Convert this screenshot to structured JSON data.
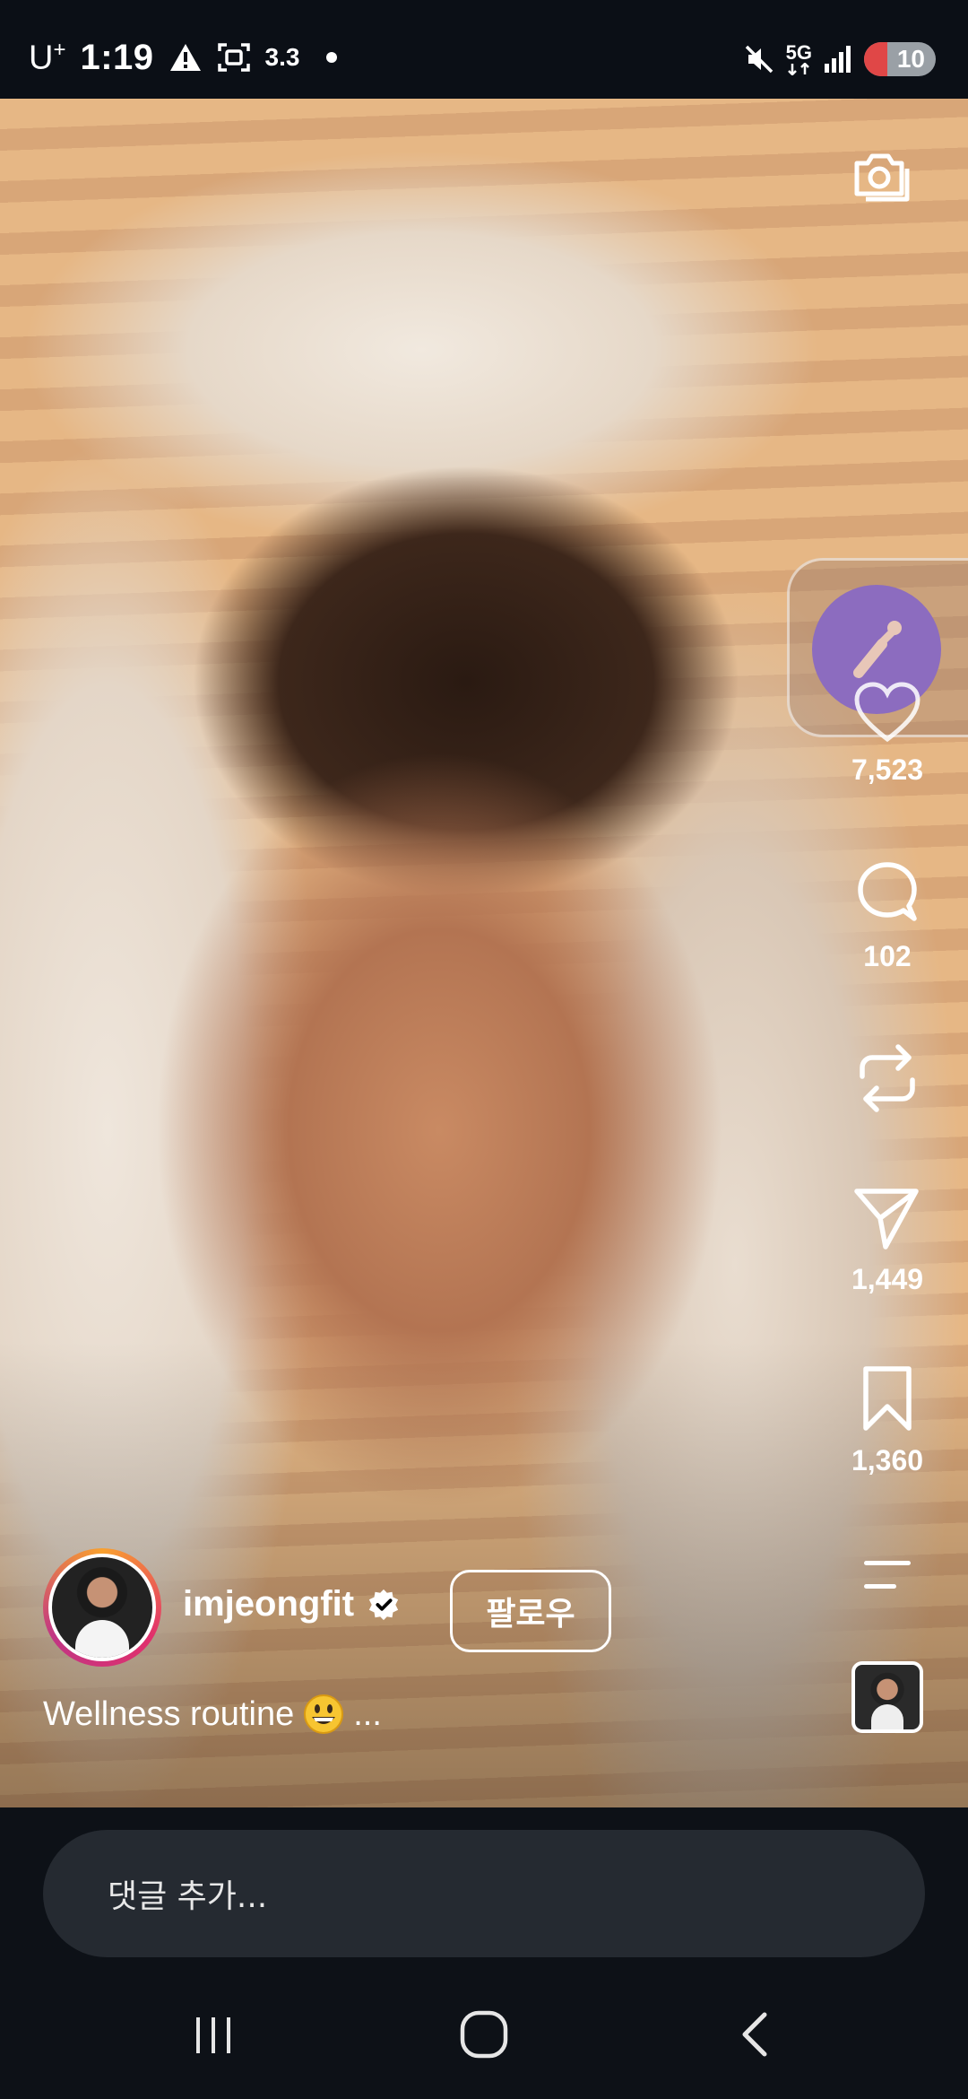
{
  "status_bar": {
    "carrier": "U",
    "carrier_sup": "+",
    "time": "1:19",
    "data_speed": "3.3",
    "network_type": "5G",
    "battery_level": "10",
    "icons": [
      "warning-icon",
      "screen-capture-icon",
      "mute-icon",
      "signal-icon",
      "battery-icon"
    ]
  },
  "reel": {
    "actions": {
      "likes": "7,523",
      "comments": "102",
      "shares": "1,449",
      "saves": "1,360"
    },
    "author": {
      "username": "imjeongfit",
      "verified": true,
      "follow_label": "팔로우"
    },
    "caption": {
      "text": "Wellness routine",
      "more": "..."
    }
  },
  "comment_bar": {
    "placeholder": "댓글 추가..."
  },
  "colors": {
    "background": "#0d1117",
    "input_bg": "#252a31",
    "accent_purple": "#8c6cbf"
  }
}
